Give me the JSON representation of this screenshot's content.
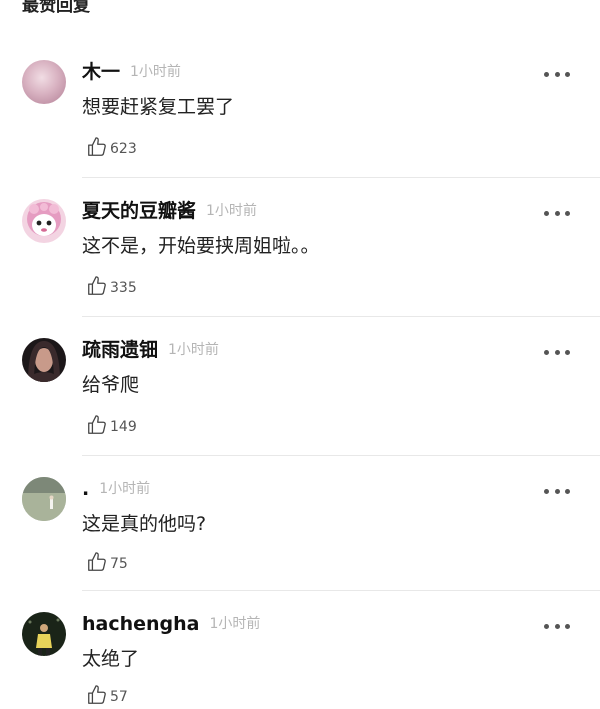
{
  "header": {
    "title": "最赞回复"
  },
  "comments": [
    {
      "name": "木一",
      "time": "1小时前",
      "text": "想要赶紧复工罢了",
      "likes": "623",
      "avatar_icon": "pink-blur-avatar-icon",
      "avatar_color": "#d8b4c4"
    },
    {
      "name": "夏天的豆瓣酱",
      "time": "1小时前",
      "text": "这不是，开始要挟周姐啦。。",
      "likes": "335",
      "avatar_icon": "cartoon-character-avatar-icon",
      "avatar_color": "#e9a9c8"
    },
    {
      "name": "疏雨遗钿",
      "time": "1小时前",
      "text": "给爷爬",
      "likes": "149",
      "avatar_icon": "dark-portrait-avatar-icon",
      "avatar_color": "#2a2226"
    },
    {
      "name": ".",
      "time": "1小时前",
      "text": "这是真的他吗?",
      "likes": "75",
      "avatar_icon": "outdoor-field-avatar-icon",
      "avatar_color": "#8a9a82"
    },
    {
      "name": "hachengha",
      "time": "1小时前",
      "text": "太绝了",
      "likes": "57",
      "avatar_icon": "night-figure-avatar-icon",
      "avatar_color": "#1e2a1c"
    }
  ]
}
